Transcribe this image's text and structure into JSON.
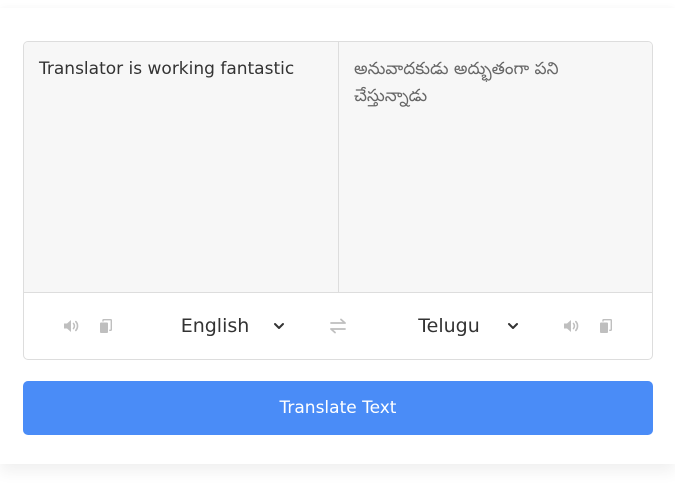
{
  "input": {
    "from_text": "Translator is working fantastic",
    "to_text": "అనువాదకుడు అద్భుతంగా పని చేస్తున్నాడు"
  },
  "controls": {
    "from_language": "English",
    "to_language": "Telugu"
  },
  "button": {
    "label": "Translate Text"
  },
  "icons": {
    "speaker": "volume-icon",
    "copy": "copy-icon",
    "exchange": "exchange-icon",
    "chevron": "chevron-down-icon"
  },
  "colors": {
    "accent": "#4a8cf7",
    "icon": "#bfbfbf",
    "textarea_bg": "#f7f7f7"
  }
}
